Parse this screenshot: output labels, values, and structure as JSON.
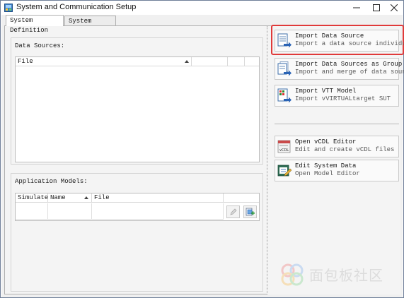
{
  "window": {
    "title": "System and Communication Setup"
  },
  "tabs": [
    {
      "label": "System Definition",
      "active": true
    },
    {
      "label": "System Explorer",
      "active": false
    }
  ],
  "data_sources": {
    "label": "Data Sources:",
    "columns": [
      "File"
    ]
  },
  "application_models": {
    "label": "Application Models:",
    "columns": [
      "Simulated",
      "Name",
      "File"
    ]
  },
  "actions": [
    {
      "title": "Import Data Source",
      "subtitle": "Import a data source individually",
      "icon": "import-document-icon",
      "highlighted": true
    },
    {
      "title": "Import Data Sources as Group",
      "subtitle": "Import and merge of data sources",
      "icon": "import-group-icon",
      "highlighted": false
    },
    {
      "title": "Import VTT Model",
      "subtitle": "Import vVIRTUALtarget SUT",
      "icon": "vtt-model-icon",
      "highlighted": false
    },
    {
      "title": "Open vCDL Editor",
      "subtitle": "Edit and create vCDL files",
      "icon": "vcdl-editor-icon",
      "highlighted": false
    },
    {
      "title": "Edit System Data",
      "subtitle": "Open Model Editor",
      "icon": "edit-system-data-icon",
      "highlighted": false
    }
  ],
  "colors": {
    "highlight": "#e03a3a",
    "accent_blue": "#2a63b5"
  },
  "watermark": {
    "text": "面包板社区"
  }
}
